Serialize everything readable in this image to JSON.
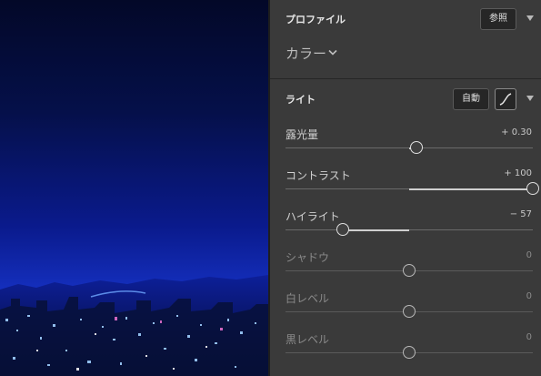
{
  "profile": {
    "title": "プロファイル",
    "browse_label": "参照",
    "current": "カラー"
  },
  "light": {
    "title": "ライト",
    "auto_label": "自動",
    "sliders": [
      {
        "key": "exposure",
        "label": "露光量",
        "value": "+ 0.30",
        "pos": 0.53,
        "dim": false
      },
      {
        "key": "contrast",
        "label": "コントラスト",
        "value": "+ 100",
        "pos": 1.0,
        "dim": false
      },
      {
        "key": "highlights",
        "label": "ハイライト",
        "value": "− 57",
        "pos": 0.23,
        "dim": false
      },
      {
        "key": "shadows",
        "label": "シャドウ",
        "value": "0",
        "pos": 0.5,
        "dim": true
      },
      {
        "key": "whites",
        "label": "白レベル",
        "value": "0",
        "pos": 0.5,
        "dim": true
      },
      {
        "key": "blacks",
        "label": "黒レベル",
        "value": "0",
        "pos": 0.5,
        "dim": true
      }
    ]
  },
  "colors": {
    "panel": "#3a3a3a",
    "track": "#6a6a6a",
    "fill": "#cfcfcf"
  }
}
